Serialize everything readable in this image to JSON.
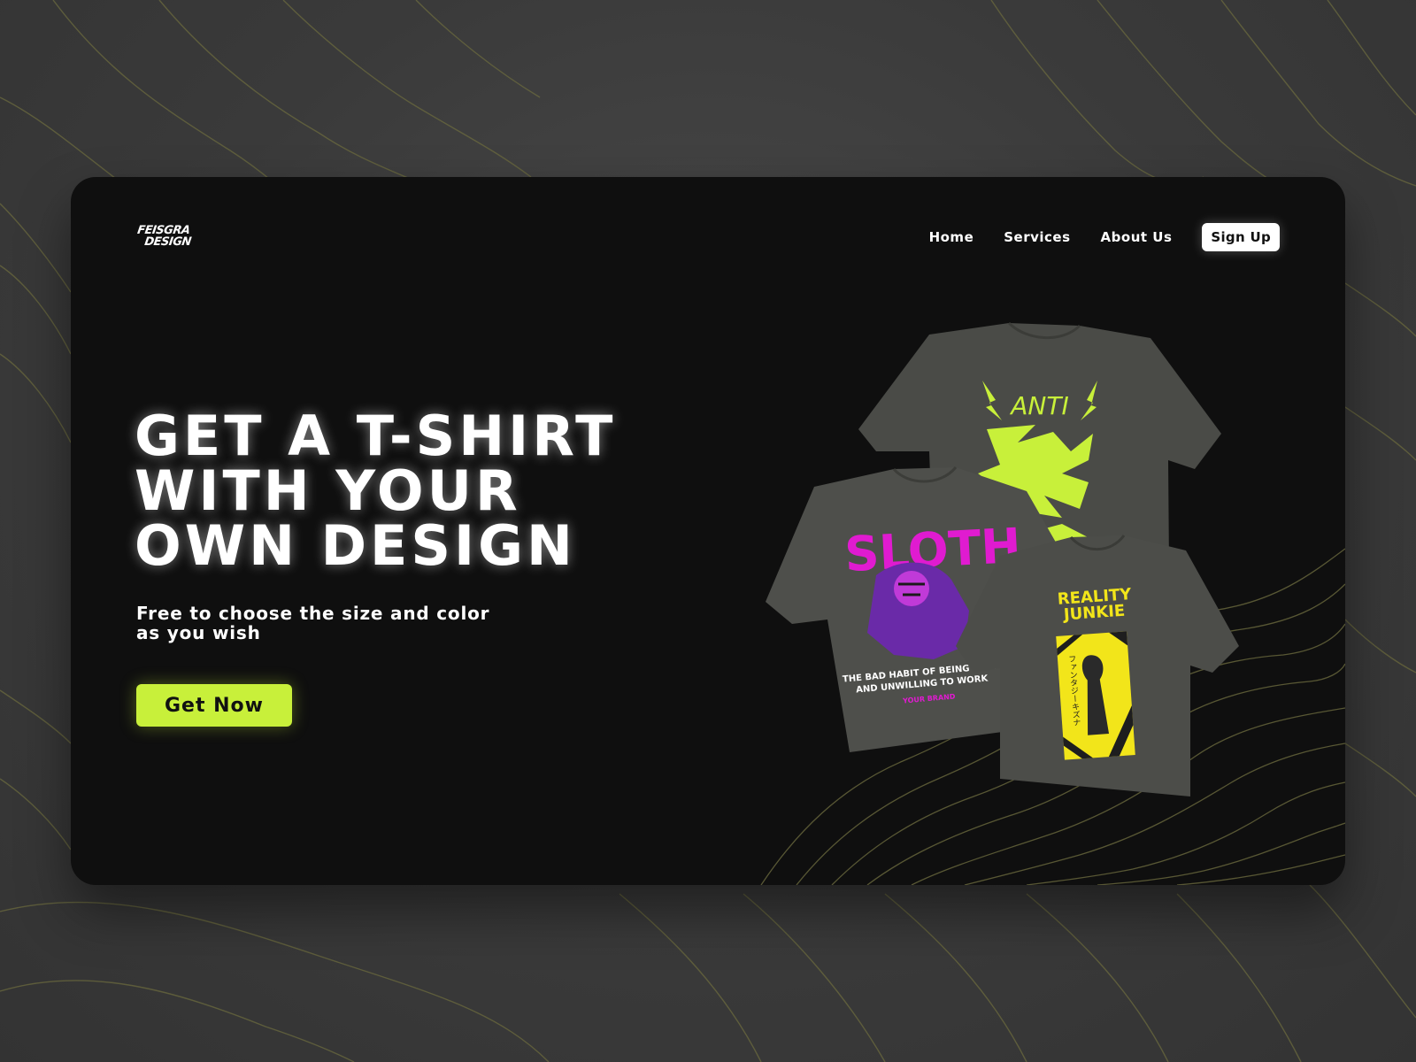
{
  "brand": {
    "logo_line1": "FEISGRA",
    "logo_line2": "DESIGN"
  },
  "nav": {
    "items": [
      {
        "label": "Home"
      },
      {
        "label": "Services"
      },
      {
        "label": "About Us"
      }
    ],
    "signup_label": "Sign Up"
  },
  "hero": {
    "title_lines": [
      "GET A T-SHIRT",
      "WITH YOUR",
      "OWN DESIGN"
    ],
    "subtitle_lines": [
      "Free to choose the size and color",
      "as you wish"
    ],
    "cta_label": "Get Now"
  },
  "products": {
    "shirt_anti": {
      "print_text": "ANTI"
    },
    "shirt_sloth": {
      "print_text": "SLOTH",
      "caption_line1": "THE BAD HABIT OF BEING LAZY",
      "caption_line2": "AND UNWILLING TO WORK",
      "brand_tag": "YOUR BRAND"
    },
    "shirt_reality": {
      "print_text_line1": "REALITY",
      "print_text_line2": "JUNKIE",
      "japanese_text": "ファンタジーキズナ"
    }
  },
  "colors": {
    "accent": "#c8f03a",
    "card_bg": "#0f0f0f",
    "page_bg": "#3d3d3d",
    "shirt": "#4a4b47",
    "sloth_pink": "#e01bd0",
    "reality_yellow": "#f2e51a"
  }
}
